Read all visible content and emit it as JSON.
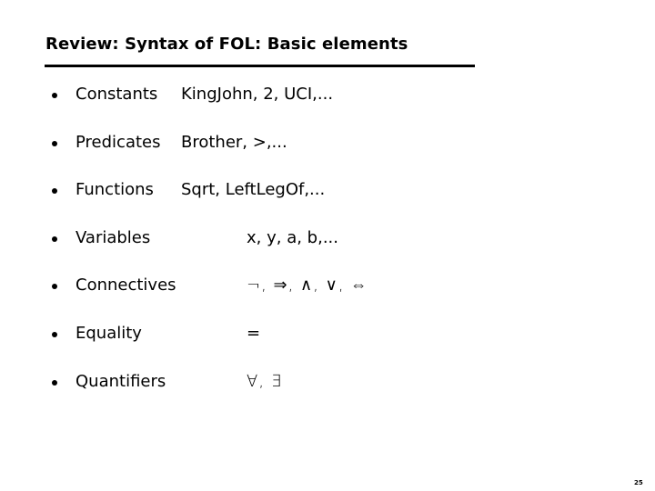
{
  "slide": {
    "title": "Review: Syntax of FOL: Basic elements",
    "items": [
      {
        "term": "Constants",
        "value": "KingJohn, 2, UCI,..."
      },
      {
        "term": "Predicates",
        "value": "Brother, >,..."
      },
      {
        "term": "Functions",
        "value": "Sqrt, LeftLegOf,..."
      },
      {
        "term": "Variables",
        "value": "x, y, a, b,..."
      },
      {
        "term": "Connectives",
        "value": "¬, ⇒, ∧, ∨, ⇔"
      },
      {
        "term": "Equality",
        "value": "="
      },
      {
        "term": "Quantifiers",
        "value": "∀, ∃"
      }
    ],
    "page_number": "25"
  }
}
